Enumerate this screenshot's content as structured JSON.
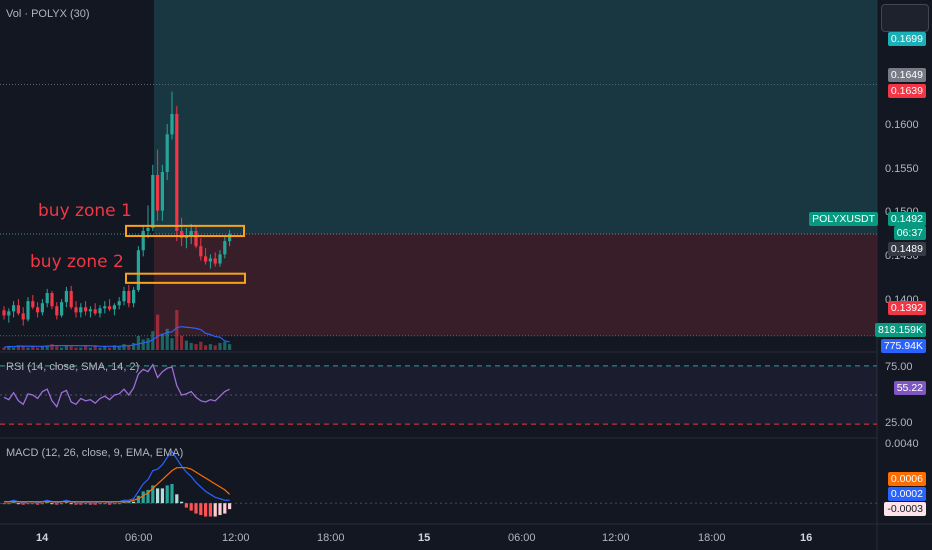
{
  "volume_legend": "Vol · POLYX (30)",
  "rsi_legend": "RSI (14, close, SMA, 14, 2)",
  "macd_legend": "MACD (12, 26, close, 9, EMA, EMA)",
  "annotations": {
    "zone1": "buy zone 1",
    "zone2": "buy zone 2"
  },
  "price_axis": {
    "ticks": [
      "0.1600",
      "0.1550",
      "0.1500",
      "0.1450",
      "0.1400"
    ],
    "tags": {
      "target": "0.1699",
      "high": "0.1649",
      "high_red": "0.1639",
      "symbol": "POLYXUSDT",
      "last": "0.1492",
      "countdown": "06:37",
      "prev": "0.1489",
      "stop": "0.1392",
      "vol1": "818.159K",
      "vol2": "775.94K"
    }
  },
  "rsi_axis": {
    "top": "75.00",
    "value": "55.22",
    "bottom": "25.00"
  },
  "macd_axis": {
    "top": "0.0040",
    "v1": "0.0006",
    "v2": "0.0002",
    "v3": "-0.0003"
  },
  "time_axis": [
    "14",
    "06:00",
    "12:00",
    "18:00",
    "15",
    "06:00",
    "12:00",
    "18:00",
    "16"
  ],
  "colors": {
    "up": "#26a69a",
    "down": "#f23645",
    "profit_zone": "#1a3d45",
    "loss_zone": "#3d1f2a",
    "zone_box": "#f7a21b",
    "rsi_line": "#9c6fd6"
  },
  "chart_data": {
    "type": "candlestick",
    "interval_minutes": 30,
    "ylim": [
      0.1378,
      0.1722
    ],
    "position": {
      "entry": 0.1492,
      "target": 0.1699,
      "stop": 0.1392
    },
    "buy_zones": [
      {
        "name": "buy zone 1",
        "top": 0.15,
        "bottom": 0.149
      },
      {
        "name": "buy zone 2",
        "top": 0.1453,
        "bottom": 0.1444
      }
    ],
    "candles": [
      [
        0.1417,
        0.1421,
        0.1408,
        0.1412
      ],
      [
        0.1412,
        0.1419,
        0.1405,
        0.1416
      ],
      [
        0.1416,
        0.1426,
        0.141,
        0.1422
      ],
      [
        0.1422,
        0.1428,
        0.1412,
        0.1414
      ],
      [
        0.1414,
        0.142,
        0.1402,
        0.1408
      ],
      [
        0.1408,
        0.143,
        0.1406,
        0.1426
      ],
      [
        0.1426,
        0.1432,
        0.1418,
        0.142
      ],
      [
        0.142,
        0.1425,
        0.141,
        0.1415
      ],
      [
        0.1415,
        0.1428,
        0.1412,
        0.1424
      ],
      [
        0.1424,
        0.1438,
        0.142,
        0.1434
      ],
      [
        0.1434,
        0.1436,
        0.1418,
        0.1421
      ],
      [
        0.1421,
        0.1425,
        0.1408,
        0.1412
      ],
      [
        0.1412,
        0.1428,
        0.141,
        0.1425
      ],
      [
        0.1425,
        0.144,
        0.142,
        0.1436
      ],
      [
        0.1436,
        0.1441,
        0.1418,
        0.142
      ],
      [
        0.142,
        0.1426,
        0.141,
        0.1415
      ],
      [
        0.1415,
        0.1424,
        0.141,
        0.142
      ],
      [
        0.142,
        0.1426,
        0.1412,
        0.1416
      ],
      [
        0.1416,
        0.1421,
        0.141,
        0.1418
      ],
      [
        0.1418,
        0.1424,
        0.1412,
        0.1414
      ],
      [
        0.1414,
        0.1422,
        0.141,
        0.1419
      ],
      [
        0.1419,
        0.1426,
        0.1414,
        0.1421
      ],
      [
        0.1421,
        0.1428,
        0.1416,
        0.1418
      ],
      [
        0.1418,
        0.1424,
        0.1412,
        0.1422
      ],
      [
        0.1422,
        0.143,
        0.1418,
        0.1426
      ],
      [
        0.1426,
        0.144,
        0.1422,
        0.1436
      ],
      [
        0.1436,
        0.1442,
        0.142,
        0.1424
      ],
      [
        0.1424,
        0.144,
        0.142,
        0.1437
      ],
      [
        0.1437,
        0.148,
        0.1435,
        0.1476
      ],
      [
        0.1476,
        0.15,
        0.147,
        0.1495
      ],
      [
        0.1495,
        0.152,
        0.1488,
        0.1498
      ],
      [
        0.1498,
        0.156,
        0.1495,
        0.155
      ],
      [
        0.155,
        0.1575,
        0.1505,
        0.1515
      ],
      [
        0.1515,
        0.156,
        0.1505,
        0.1553
      ],
      [
        0.1553,
        0.16,
        0.1545,
        0.159
      ],
      [
        0.159,
        0.1632,
        0.1585,
        0.161
      ],
      [
        0.161,
        0.1618,
        0.1485,
        0.1495
      ],
      [
        0.1495,
        0.1508,
        0.148,
        0.1488
      ],
      [
        0.1488,
        0.1498,
        0.1478,
        0.149
      ],
      [
        0.149,
        0.1502,
        0.1482,
        0.1495
      ],
      [
        0.1495,
        0.15,
        0.1478,
        0.148
      ],
      [
        0.148,
        0.1488,
        0.1466,
        0.147
      ],
      [
        0.147,
        0.1478,
        0.1462,
        0.1465
      ],
      [
        0.1465,
        0.1472,
        0.1458,
        0.1468
      ],
      [
        0.1468,
        0.1474,
        0.146,
        0.1463
      ],
      [
        0.1463,
        0.1476,
        0.146,
        0.1472
      ],
      [
        0.1472,
        0.149,
        0.1468,
        0.1485
      ],
      [
        0.1485,
        0.1496,
        0.148,
        0.1492
      ]
    ],
    "volume": [
      2,
      3,
      2,
      4,
      3,
      2,
      3,
      2,
      3,
      4,
      5,
      3,
      2,
      4,
      3,
      2,
      2,
      3,
      2,
      3,
      2,
      3,
      2,
      4,
      3,
      5,
      4,
      6,
      12,
      9,
      10,
      16,
      30,
      14,
      18,
      10,
      34,
      12,
      8,
      6,
      5,
      7,
      4,
      5,
      4,
      6,
      7,
      5
    ],
    "rsi": [
      48,
      46,
      52,
      45,
      42,
      51,
      50,
      47,
      53,
      55,
      45,
      40,
      52,
      54,
      44,
      42,
      47,
      45,
      46,
      43,
      47,
      49,
      46,
      50,
      51,
      55,
      50,
      56,
      68,
      72,
      70,
      76,
      65,
      70,
      73,
      74,
      58,
      50,
      51,
      53,
      48,
      45,
      44,
      46,
      45,
      49,
      53,
      55
    ],
    "macd": [
      0.0001,
      0.0001,
      0.0002,
      0.0001,
      0.0,
      0.0001,
      0.0001,
      0.0,
      0.0001,
      0.0002,
      0.0001,
      0.0,
      0.0001,
      0.0002,
      0.0001,
      0.0,
      0.0,
      0.0001,
      0.0,
      0.0,
      0.0001,
      0.0001,
      0.0,
      0.0001,
      0.0001,
      0.0002,
      0.0002,
      0.0003,
      0.0008,
      0.0013,
      0.0016,
      0.0022,
      0.0023,
      0.0026,
      0.0031,
      0.0035,
      0.003,
      0.0025,
      0.0021,
      0.0018,
      0.0014,
      0.0011,
      0.0008,
      0.0006,
      0.0004,
      0.0003,
      0.0002,
      0.0002
    ],
    "signal": [
      0.0001,
      0.0001,
      0.0001,
      0.0001,
      0.0001,
      0.0001,
      0.0001,
      0.0001,
      0.0001,
      0.0001,
      0.0001,
      0.0001,
      0.0001,
      0.0001,
      0.0001,
      0.0001,
      0.0001,
      0.0001,
      0.0001,
      0.0001,
      0.0001,
      0.0001,
      0.0001,
      0.0001,
      0.0001,
      0.0001,
      0.0001,
      0.0002,
      0.0003,
      0.0005,
      0.0007,
      0.001,
      0.0013,
      0.0016,
      0.0019,
      0.0022,
      0.0024,
      0.0024,
      0.0024,
      0.0023,
      0.0021,
      0.0019,
      0.0017,
      0.0015,
      0.0013,
      0.0011,
      0.0009,
      0.0006
    ]
  }
}
